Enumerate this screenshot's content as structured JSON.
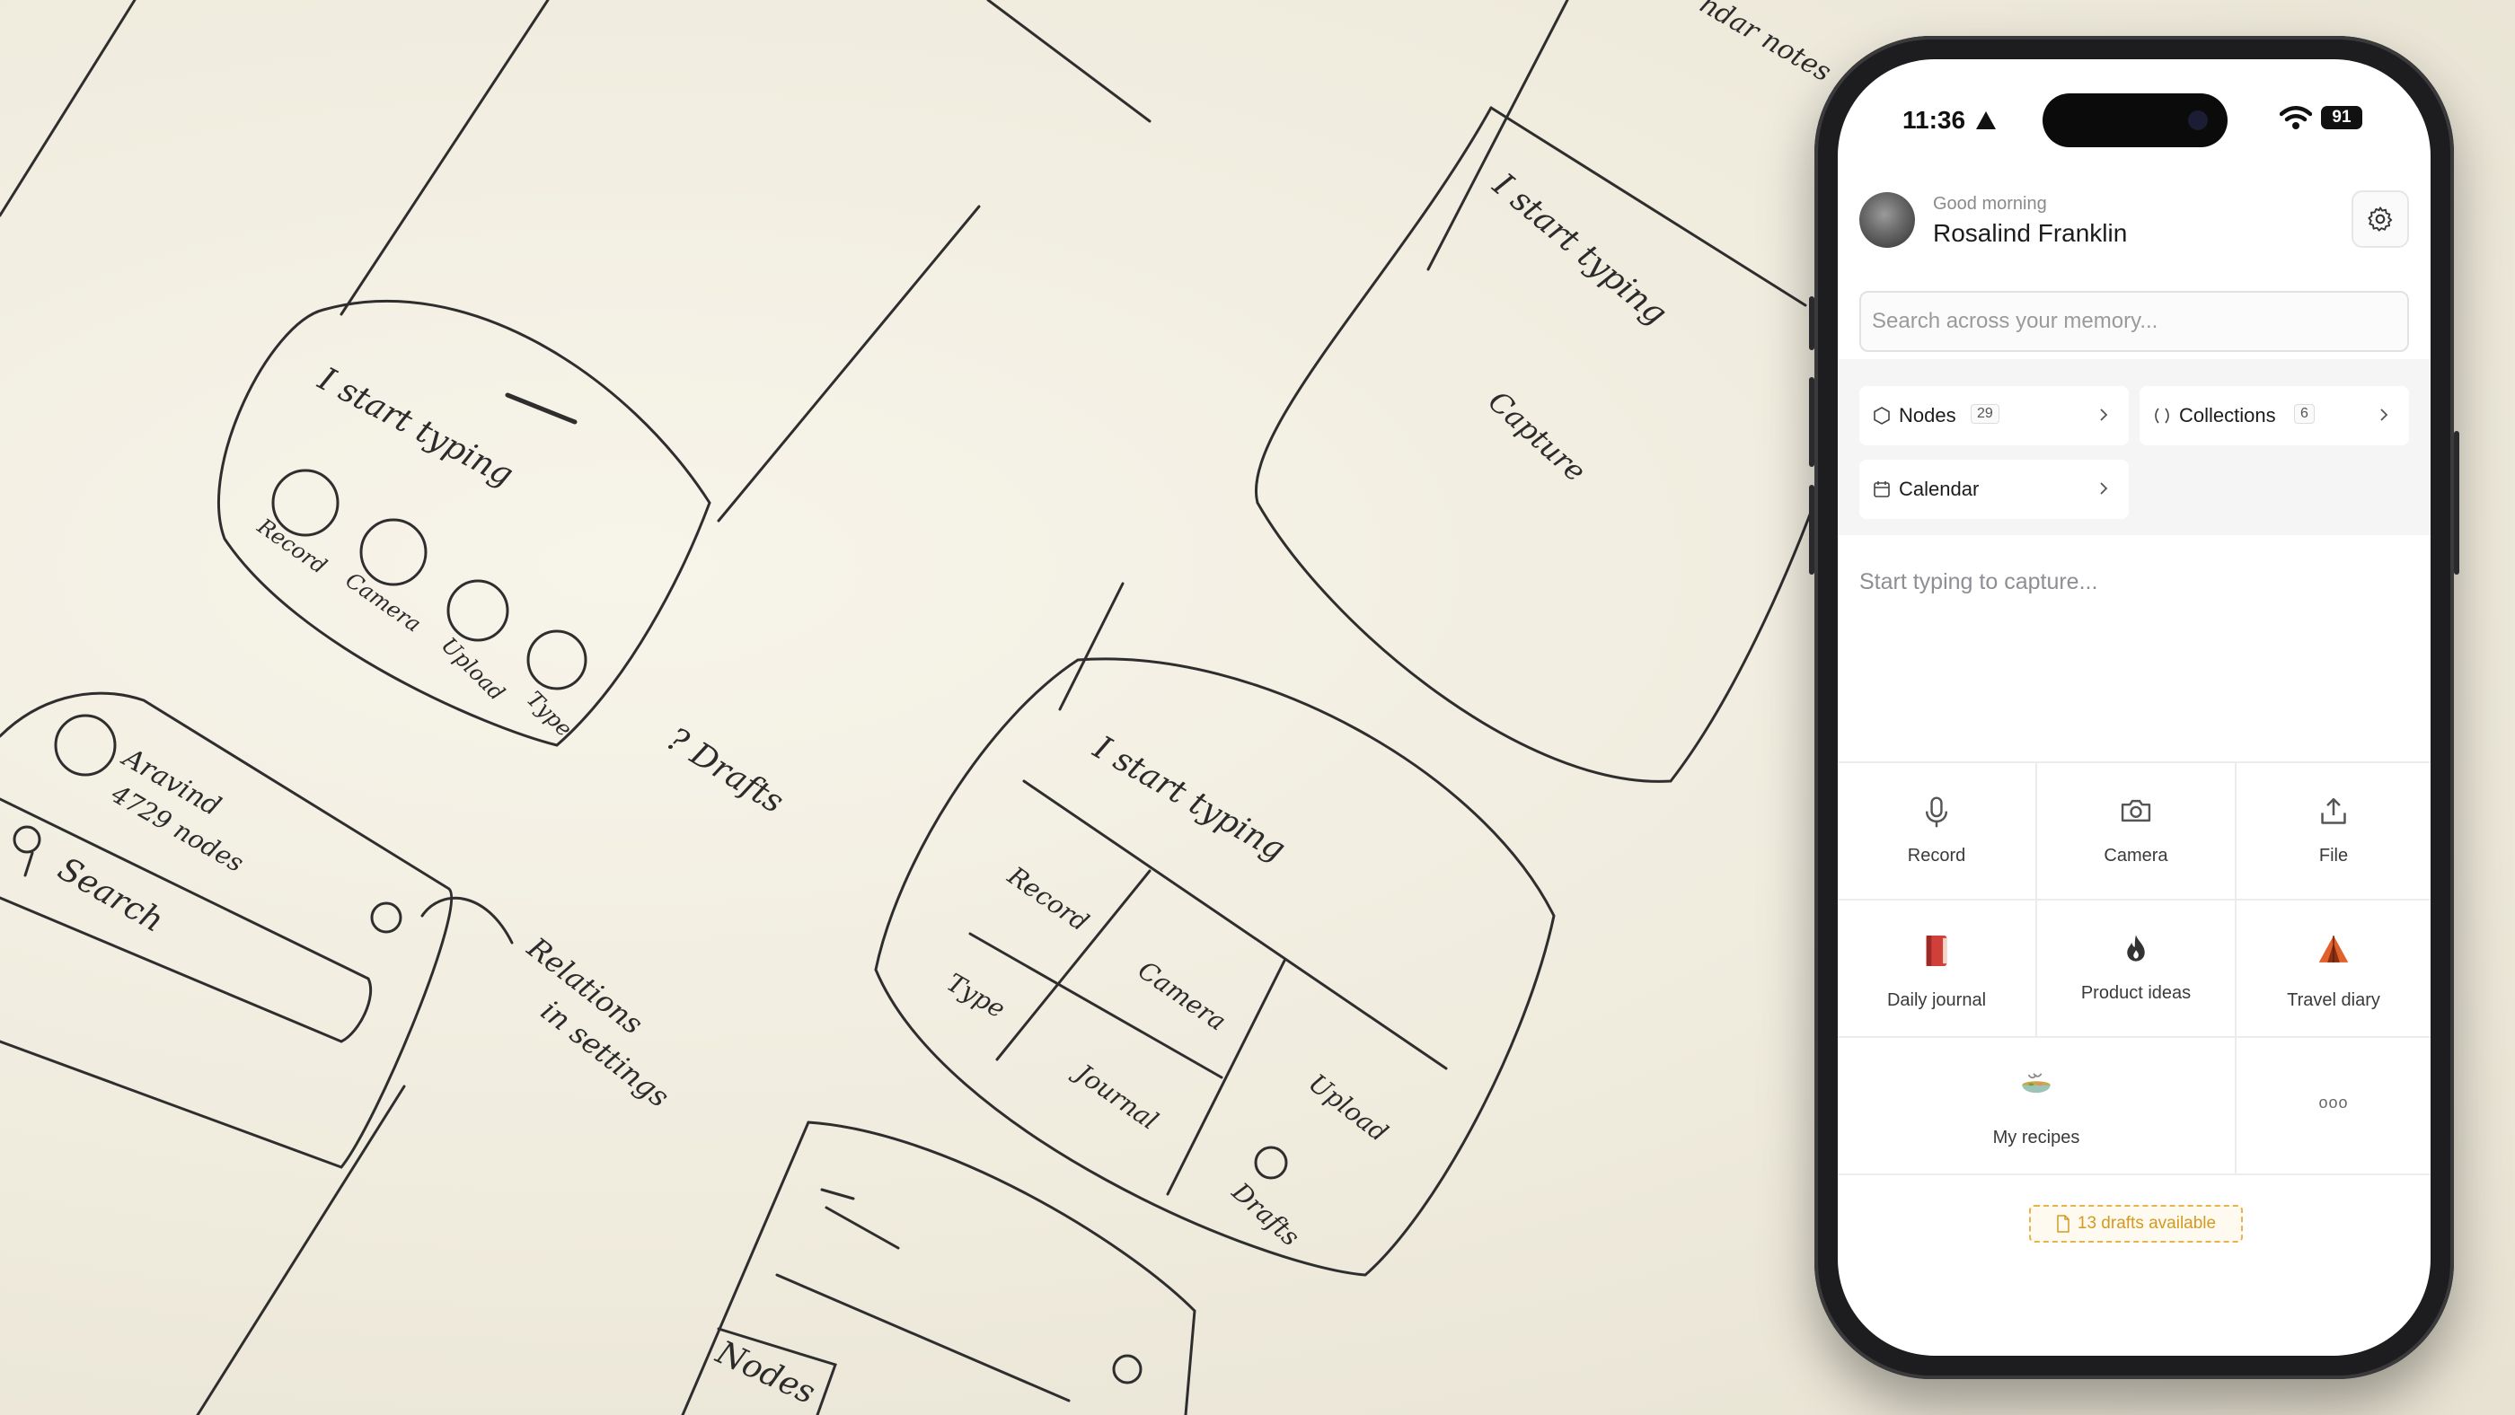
{
  "sketch": {
    "frame_a": {
      "placeholder": "I start typing",
      "actions": [
        "Record",
        "Camera",
        "Upload",
        "Type"
      ]
    },
    "drafts_note": "? Drafts",
    "frame_b": {
      "user": "Aravind",
      "nodes": "4729 nodes",
      "search": "Search"
    },
    "relations_note": [
      "Relations",
      "in settings"
    ],
    "frame_c": {
      "placeholder": "I start typing",
      "actions": [
        "Record",
        "Camera",
        "Type",
        "Journal",
        "Upload",
        "Drafts"
      ]
    },
    "frame_d": {
      "placeholder": "I start typing",
      "capture": "Capture"
    },
    "frame_e": {
      "nodes": "Nodes"
    },
    "corner_note": "ndar notes"
  },
  "phone": {
    "status": {
      "time": "11:36",
      "battery": "91"
    },
    "header": {
      "greeting": "Good morning",
      "name": "Rosalind Franklin"
    },
    "search": {
      "placeholder": "Search across your memory..."
    },
    "nav": {
      "nodes": {
        "label": "Nodes",
        "count": "29"
      },
      "collections": {
        "label": "Collections",
        "count": "6"
      },
      "calendar": {
        "label": "Calendar"
      }
    },
    "capture": {
      "placeholder": "Start typing to capture..."
    },
    "actions": {
      "record": "Record",
      "camera": "Camera",
      "file": "File",
      "daily_journal": "Daily journal",
      "product_ideas": "Product ideas",
      "travel_diary": "Travel diary",
      "my_recipes": "My recipes",
      "more": "ooo"
    },
    "drafts": {
      "label": "13 drafts available"
    },
    "colors": {
      "accent": "#d39a22",
      "journal": "#d0403a",
      "travel": "#e0612b"
    }
  }
}
